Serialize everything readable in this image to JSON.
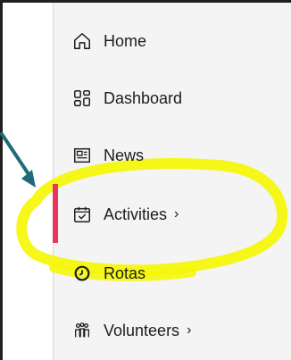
{
  "nav": {
    "items": [
      {
        "label": "Home",
        "icon": "home-icon"
      },
      {
        "label": "Dashboard",
        "icon": "dashboard-icon"
      },
      {
        "label": "News",
        "icon": "news-icon"
      },
      {
        "label": "Activities",
        "icon": "calendar-check-icon",
        "chevron": "›",
        "active": true
      },
      {
        "label": "Rotas",
        "icon": "clock-icon"
      },
      {
        "label": "Volunteers",
        "icon": "people-icon",
        "chevron": "›"
      }
    ]
  },
  "colors": {
    "active_bar": "#e8375e",
    "highlight": "#f5f700",
    "arrow": "#1f6a7a"
  }
}
